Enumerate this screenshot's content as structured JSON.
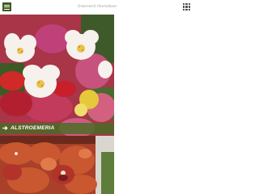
{
  "header": {
    "title": "Österreich Floristikum",
    "menu_icon": "hamburger-menu-icon",
    "grid_icon": "grid-menu-icon"
  },
  "tiles": [
    {
      "caption": "ALSTROEMERIA",
      "caption_icon": "arrow-right-icon",
      "accent_color": "#466e23"
    },
    {
      "caption": ""
    }
  ],
  "colors": {
    "accent": "#3d5a1f",
    "caption_bar": "#466e23",
    "title_text": "#9a9a9a"
  }
}
